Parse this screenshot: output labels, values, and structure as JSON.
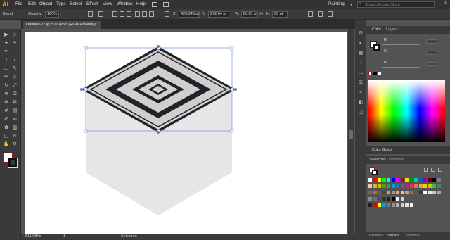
{
  "app": {
    "logo": "Ai"
  },
  "menu": [
    "File",
    "Edit",
    "Object",
    "Type",
    "Select",
    "Effect",
    "View",
    "Window",
    "Help"
  ],
  "workspace": "Painting",
  "search": {
    "placeholder": "Search Adobe Stock"
  },
  "control": {
    "mode": "Blend",
    "opacity_label": "Opacity:",
    "opacity_value": "100%",
    "x_label": "X:",
    "x_value": "420.946 pt",
    "y_label": "Y:",
    "y_value": "272.64 pt",
    "w_label": "W:",
    "w_value": "86.61 pt",
    "h_label": "H:",
    "h_value": "50 pt"
  },
  "document": {
    "tab": "Untitled-1* @ 511.68% (RGB/Preview)"
  },
  "status": {
    "zoom": "511.68%",
    "page": "1",
    "tool": "Selection"
  },
  "panels": {
    "color": {
      "tab_active": "Color",
      "tab_other": "Layers",
      "r": "R",
      "g": "G",
      "b": "B"
    },
    "guide": "Color Guide",
    "swatches": {
      "tab_active": "Swatches",
      "tab_other": "Libraries"
    },
    "bottom": [
      "Brushes",
      "Stroke",
      "Symbols"
    ]
  },
  "icons": {
    "toolbar": [
      "selection-tool",
      "direct-selection-tool",
      "magic-wand-tool",
      "lasso-tool",
      "pen-tool",
      "curvature-tool",
      "type-tool",
      "line-tool",
      "rectangle-tool",
      "paintbrush-tool",
      "pencil-tool",
      "shaper-tool",
      "rotate-tool",
      "scale-tool",
      "width-tool",
      "free-transform-tool",
      "shape-builder-tool",
      "perspective-tool",
      "mesh-tool",
      "gradient-tool",
      "eyedropper-tool",
      "blend-tool",
      "symbol-sprayer-tool",
      "graph-tool",
      "artboard-tool",
      "slice-tool",
      "hand-tool",
      "zoom-tool"
    ]
  },
  "colors": {
    "accent": "#ff9a00",
    "artboard": "#ffffff",
    "shape_fill": "#d0d0d0",
    "shape_stroke": "#222229",
    "shadow": "#e6e6e8",
    "bbox": "#5c7cc8"
  },
  "swatches": [
    [
      "#ffffff",
      "#ff0000",
      "#ffff00",
      "#00ff00",
      "#00ffff",
      "#0000ff",
      "#ff00ff",
      "#c80000",
      "#e6e600",
      "#009b00",
      "#00c8c8",
      "#0064c8",
      "#9b009b",
      "#640000",
      "#000000",
      "#808080"
    ],
    [
      "#f2c9a0",
      "#e6b020",
      "#c8c800",
      "#649b00",
      "#00b46e",
      "#00a0c8",
      "#3c64b4",
      "#7850a0",
      "#b4287a",
      "#e6325a",
      "#f0733c",
      "#f5a046",
      "#ffc800",
      "#b4d200",
      "#50b432",
      "#288c78"
    ],
    [
      "#8c6446",
      "#a07850",
      "#785a3c",
      "#643c28",
      "#c8a078",
      "#b48c64",
      "#d2b48c",
      "#e6c8a0",
      "#bea082",
      "#967350",
      "#6e5032",
      "#4b321e",
      "#ffffff",
      "#e6e6e6",
      "#c8c8c8",
      "#aaaaaa"
    ],
    [
      "#8c8c8c",
      "#6e6e6e",
      "#505050",
      "#323232",
      "#1e1e1e",
      "#000000",
      "#f0f0f0",
      "#d2d2d2"
    ],
    [
      "#1e1e1e",
      "#e60000",
      "#ffff00",
      "#00a0e6",
      "#787878",
      "#969696",
      "#b4b4b4",
      "#d2d2d2",
      "#e6e6e6",
      "#f5f5f5"
    ]
  ]
}
